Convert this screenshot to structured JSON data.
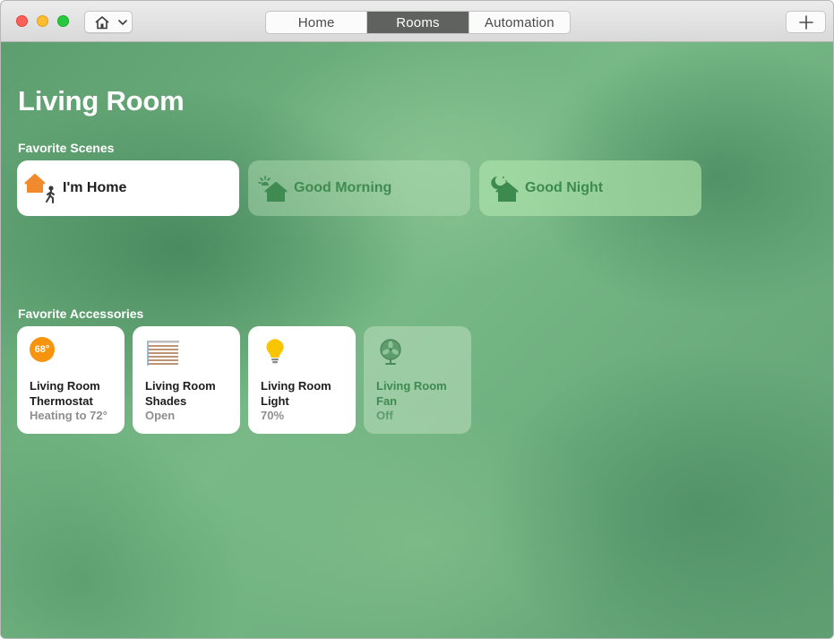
{
  "toolbar": {
    "tabs": [
      {
        "label": "Home",
        "active": false
      },
      {
        "label": "Rooms",
        "active": true
      },
      {
        "label": "Automation",
        "active": false
      }
    ],
    "home_menu_icon": "house-icon",
    "add_icon": "plus-icon"
  },
  "room": {
    "title": "Living Room"
  },
  "favorite_scenes": {
    "label": "Favorite Scenes",
    "items": [
      {
        "label": "I'm Home",
        "icon": "arrive-home-icon",
        "active": true
      },
      {
        "label": "Good Morning",
        "icon": "morning-sun-house-icon",
        "active": false
      },
      {
        "label": "Good Night",
        "icon": "night-moon-house-icon",
        "active": false
      }
    ]
  },
  "favorite_accessories": {
    "label": "Favorite Accessories",
    "items": [
      {
        "name": "Living Room Thermostat",
        "status": "Heating to 72°",
        "badge": "68°",
        "icon": "thermostat-icon",
        "active": true
      },
      {
        "name": "Living Room Shades",
        "status": "Open",
        "icon": "shades-icon",
        "active": true
      },
      {
        "name": "Living Room Light",
        "status": "70%",
        "icon": "lightbulb-icon",
        "active": true
      },
      {
        "name": "Living Room Fan",
        "status": "Off",
        "icon": "fan-icon",
        "active": false
      }
    ]
  },
  "colors": {
    "active_tab": "#5f625f",
    "thermostat_orange": "#f7940d",
    "bulb_yellow": "#f9c400",
    "scene_green": "#3f8b52"
  }
}
